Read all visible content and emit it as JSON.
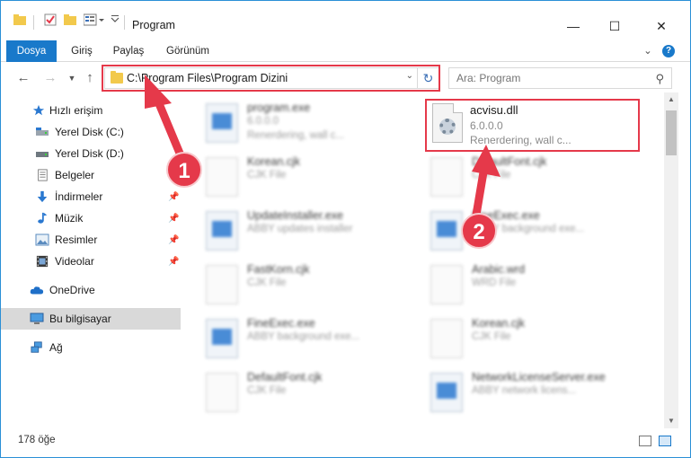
{
  "window": {
    "title": "Program",
    "minimize": "—",
    "maximize": "☐",
    "close": "✕"
  },
  "ribbon": {
    "tabs": [
      {
        "label": "Dosya",
        "active": true
      },
      {
        "label": "Giriş",
        "active": false
      },
      {
        "label": "Paylaş",
        "active": false
      },
      {
        "label": "Görünüm",
        "active": false
      }
    ],
    "expand": "⌄",
    "help": "?"
  },
  "address": {
    "path": "C:\\Program Files\\Program Dizini",
    "search_placeholder": "Ara: Program"
  },
  "sidebar": {
    "items": [
      {
        "label": "Hızlı erişim",
        "icon": "star-icon",
        "pinned": false
      },
      {
        "label": "Yerel Disk (C:)",
        "icon": "drive-icon",
        "pinned": false
      },
      {
        "label": "Yerel Disk (D:)",
        "icon": "drive-icon",
        "pinned": false
      },
      {
        "label": "Belgeler",
        "icon": "documents-icon",
        "pinned": false
      },
      {
        "label": "İndirmeler",
        "icon": "download-icon",
        "pinned": true
      },
      {
        "label": "Müzik",
        "icon": "music-icon",
        "pinned": true
      },
      {
        "label": "Resimler",
        "icon": "pictures-icon",
        "pinned": true
      },
      {
        "label": "Videolar",
        "icon": "video-icon",
        "pinned": true
      },
      {
        "label": "OneDrive",
        "icon": "cloud-icon",
        "pinned": false
      },
      {
        "label": "Bu bilgisayar",
        "icon": "computer-icon",
        "pinned": false,
        "selected": true
      },
      {
        "label": "Ağ",
        "icon": "network-icon",
        "pinned": false
      }
    ]
  },
  "files": [
    {
      "name": "program.exe",
      "type": "6.0.0.0",
      "desc": "Renerdering, wall c...",
      "kind": "exe"
    },
    {
      "name": "Korean.cjk",
      "type": "CJK File",
      "kind": "doc"
    },
    {
      "name": "DefaultFont.cjk",
      "type": "CJK File",
      "kind": "doc"
    },
    {
      "name": "UpdateInstaller.exe",
      "type": "ABBY updates installer",
      "kind": "exe"
    },
    {
      "name": "FineExec.exe",
      "type": "ABBY background exe...",
      "kind": "exe"
    },
    {
      "name": "FastKorn.cjk",
      "type": "CJK File",
      "kind": "doc"
    },
    {
      "name": "Arabic.wrd",
      "type": "WRD File",
      "kind": "doc"
    },
    {
      "name": "FineExec.exe",
      "type": "ABBY background exe...",
      "kind": "exe"
    },
    {
      "name": "Korean.cjk",
      "type": "CJK File",
      "kind": "doc"
    },
    {
      "name": "DefaultFont.cjk",
      "type": "CJK File",
      "kind": "doc"
    },
    {
      "name": "NetworkLicenseServer.exe",
      "type": "ABBY network licens...",
      "kind": "exe"
    }
  ],
  "target_file": {
    "name": "acvisu.dll",
    "version": "6.0.0.0",
    "desc": "Renerdering, wall c..."
  },
  "annotations": {
    "step1": "1",
    "step2": "2",
    "color": "#e5394a"
  },
  "status": {
    "count": "178 öğe"
  }
}
